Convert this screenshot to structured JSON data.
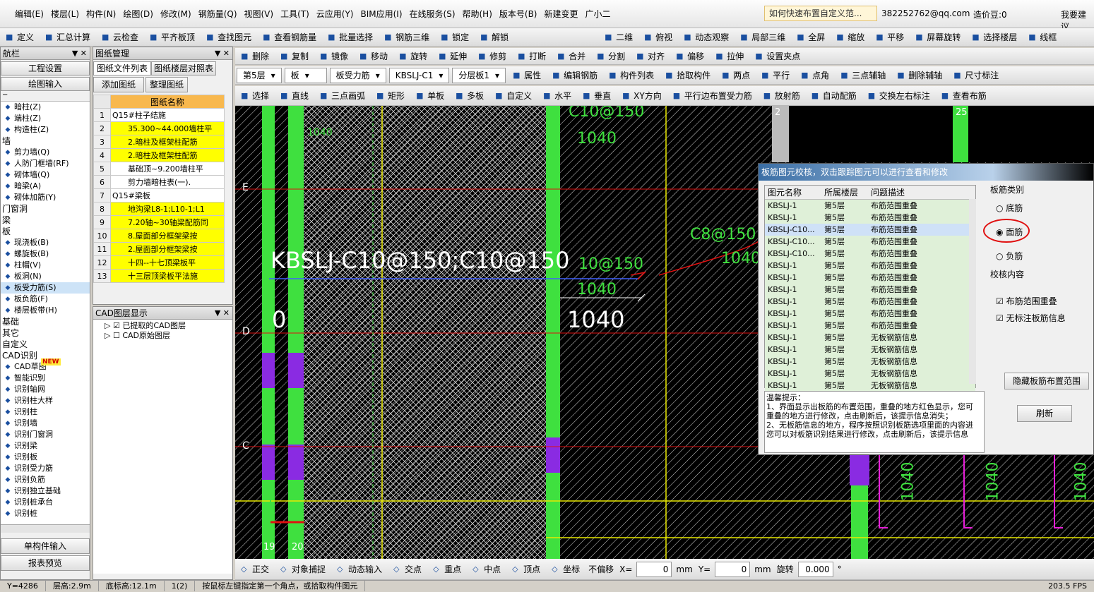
{
  "menu": [
    "编辑(E)",
    "楼层(L)",
    "构件(N)",
    "绘图(D)",
    "修改(M)",
    "钢筋量(Q)",
    "视图(V)",
    "工具(T)",
    "云应用(Y)",
    "BIM应用(I)",
    "在线服务(S)",
    "帮助(H)",
    "版本号(B)",
    "新建变更",
    "广小二"
  ],
  "menu_right": {
    "search_hint": "如何快速布置自定义范...",
    "account": "382252762@qq.com",
    "beans": "造价豆:0",
    "suggest": "我要建议"
  },
  "toolbar1": [
    "定义",
    "汇总计算",
    "云检查",
    "平齐板顶",
    "查找图元",
    "查看钢筋量",
    "批量选择",
    "钢筋三维",
    "锁定",
    "解锁"
  ],
  "toolbar1_right": [
    "二维",
    "俯视",
    "动态观察",
    "局部三维",
    "全屏",
    "缩放",
    "平移",
    "屏幕旋转",
    "选择楼层",
    "线框"
  ],
  "toolbar2": [
    "删除",
    "复制",
    "镜像",
    "移动",
    "旋转",
    "延伸",
    "修剪",
    "打断",
    "合并",
    "分割",
    "对齐",
    "偏移",
    "拉伸",
    "设置夹点"
  ],
  "toolbar3": {
    "floor": "第5层",
    "type": "板",
    "subtype": "板受力筋",
    "element": "KBSLJ-C1",
    "layer": "分层板1",
    "buttons": [
      "属性",
      "编辑钢筋",
      "构件列表",
      "拾取构件",
      "两点",
      "平行",
      "点角",
      "三点辅轴",
      "删除辅轴",
      "尺寸标注"
    ]
  },
  "toolbar4": [
    "选择",
    "直线",
    "三点画弧",
    "矩形",
    "单板",
    "多板",
    "自定义",
    "水平",
    "垂直",
    "XY方向",
    "平行边布置受力筋",
    "放射筋",
    "自动配筋",
    "交换左右标注",
    "查看布筋"
  ],
  "nav": {
    "title": "航栏",
    "top": [
      "工程设置",
      "绘图输入"
    ],
    "items": [
      {
        "t": "暗柱(Z)",
        "c": 0
      },
      {
        "t": "端柱(Z)",
        "c": 0
      },
      {
        "t": "构造柱(Z)",
        "c": 0
      },
      {
        "t": "墙",
        "c": 1
      },
      {
        "t": "剪力墙(Q)",
        "c": 0
      },
      {
        "t": "人防门框墙(RF)",
        "c": 0
      },
      {
        "t": "砌体墙(Q)",
        "c": 0
      },
      {
        "t": "暗梁(A)",
        "c": 0
      },
      {
        "t": "砌体加筋(Y)",
        "c": 0
      },
      {
        "t": "门窗洞",
        "c": 1
      },
      {
        "t": "梁",
        "c": 1
      },
      {
        "t": "板",
        "c": 1
      },
      {
        "t": "现浇板(B)",
        "c": 0
      },
      {
        "t": "螺旋板(B)",
        "c": 0
      },
      {
        "t": "柱帽(V)",
        "c": 0
      },
      {
        "t": "板洞(N)",
        "c": 0
      },
      {
        "t": "板受力筋(S)",
        "c": 0,
        "sel": 1
      },
      {
        "t": "板负筋(F)",
        "c": 0
      },
      {
        "t": "楼层板带(H)",
        "c": 0
      },
      {
        "t": "基础",
        "c": 1
      },
      {
        "t": "其它",
        "c": 1
      },
      {
        "t": "自定义",
        "c": 1
      },
      {
        "t": "CAD识别",
        "c": 1
      },
      {
        "t": "CAD草图",
        "c": 0
      },
      {
        "t": "智能识别",
        "c": 0
      },
      {
        "t": "识别轴网",
        "c": 0
      },
      {
        "t": "识别柱大样",
        "c": 0
      },
      {
        "t": "识别柱",
        "c": 0
      },
      {
        "t": "识别墙",
        "c": 0
      },
      {
        "t": "识别门窗洞",
        "c": 0
      },
      {
        "t": "识别梁",
        "c": 0
      },
      {
        "t": "识别板",
        "c": 0
      },
      {
        "t": "识别受力筋",
        "c": 0
      },
      {
        "t": "识别负筋",
        "c": 0
      },
      {
        "t": "识别独立基础",
        "c": 0
      },
      {
        "t": "识别桩承台",
        "c": 0
      },
      {
        "t": "识别桩",
        "c": 0
      }
    ],
    "bottom": [
      "单构件输入",
      "报表预览"
    ],
    "new_badge": "NEW"
  },
  "drawings": {
    "title": "图纸管理",
    "tabs": [
      "图纸文件列表",
      "图纸楼层对照表"
    ],
    "buttons": [
      "添加图纸",
      "整理图纸"
    ],
    "header": "图纸名称",
    "rows": [
      {
        "n": "1",
        "t": "Q15#柱子结施",
        "g": 1
      },
      {
        "n": "2",
        "t": "35.300~44.000墙柱平",
        "y": 1
      },
      {
        "n": "3",
        "t": "2.暗柱及框架柱配筋",
        "y": 1
      },
      {
        "n": "4",
        "t": "2.暗柱及框架柱配筋",
        "y": 1
      },
      {
        "n": "5",
        "t": "基础顶~9.200墙柱平"
      },
      {
        "n": "6",
        "t": "剪力墙暗柱表(一)."
      },
      {
        "n": "7",
        "t": "Q15#梁板",
        "g": 1
      },
      {
        "n": "8",
        "t": "地沟梁L8-1;L10-1;L1",
        "y": 1
      },
      {
        "n": "9",
        "t": "7.20轴~30轴梁配筋同",
        "y": 1
      },
      {
        "n": "10",
        "t": "8.屋面部分框架梁按",
        "y": 1
      },
      {
        "n": "11",
        "t": "2.屋面部分框架梁按",
        "y": 1
      },
      {
        "n": "12",
        "t": "十四--十七顶梁板平",
        "y": 1
      },
      {
        "n": "13",
        "t": "十三层顶梁板平法施",
        "y": 1
      }
    ]
  },
  "cad_layers": {
    "title": "CAD图层显示",
    "items": [
      "已提取的CAD图层",
      "CAD原始图层"
    ]
  },
  "canvas": {
    "labels": {
      "c10a": "C10@150",
      "n1040a": "1040",
      "main": "KBSLJ-C10@150;C10@150",
      "c10b": "10@150",
      "n1040b": "1040",
      "zero": "0",
      "n1040c": "1040",
      "c8": "C8@150",
      "n1040d": "1040",
      "e": "E",
      "d": "D",
      "c": "C",
      "v1": "1040",
      "v2": "1040",
      "v3": "1040",
      "a19": "19",
      "a20": "20",
      "n2": "2",
      "n25": "25",
      "w1040": "1040"
    }
  },
  "dialog": {
    "title": "板筋图元校核，双击跟踪图元可以进行查看和修改",
    "cols": [
      "图元名称",
      "所属楼层",
      "问题描述"
    ],
    "rows": [
      [
        "KBSLJ-1",
        "第5层",
        "布筋范围重叠"
      ],
      [
        "KBSLJ-1",
        "第5层",
        "布筋范围重叠"
      ],
      [
        "KBSLJ-C10...",
        "第5层",
        "布筋范围重叠"
      ],
      [
        "KBSLJ-C10...",
        "第5层",
        "布筋范围重叠"
      ],
      [
        "KBSLJ-C10...",
        "第5层",
        "布筋范围重叠"
      ],
      [
        "KBSLJ-1",
        "第5层",
        "布筋范围重叠"
      ],
      [
        "KBSLJ-1",
        "第5层",
        "布筋范围重叠"
      ],
      [
        "KBSLJ-1",
        "第5层",
        "布筋范围重叠"
      ],
      [
        "KBSLJ-1",
        "第5层",
        "布筋范围重叠"
      ],
      [
        "KBSLJ-1",
        "第5层",
        "布筋范围重叠"
      ],
      [
        "KBSLJ-1",
        "第5层",
        "布筋范围重叠"
      ],
      [
        "KBSLJ-1",
        "第5层",
        "无板钢筋信息"
      ],
      [
        "KBSLJ-1",
        "第5层",
        "无板钢筋信息"
      ],
      [
        "KBSLJ-1",
        "第5层",
        "无板钢筋信息"
      ],
      [
        "KBSLJ-1",
        "第5层",
        "无板钢筋信息"
      ],
      [
        "KBSLJ-1",
        "第5层",
        "无板钢筋信息"
      ]
    ],
    "tip_title": "温馨提示：",
    "tips": [
      "1、界面显示出板筋的布置范围，重叠的地方红色显示，您可",
      "重叠的地方进行修改，点击刷新后，该提示信息消失；",
      "2、无板筋信息的地方，程序按照识别板筋选项里面的内容进",
      "您可以对板筋识别结果进行修改，点击刷新后，该提示信息"
    ],
    "cat_title": "板筋类别",
    "cats": [
      "底筋",
      "面筋",
      "负筋"
    ],
    "check_title": "校核内容",
    "checks": [
      "布筋范围重叠",
      "无标注板筋信息"
    ],
    "hide_btn": "隐藏板筋布置范围",
    "refresh_btn": "刷新"
  },
  "snapbar": {
    "items": [
      "正交",
      "对象捕捉",
      "动态输入",
      "交点",
      "重点",
      "中点",
      "顶点",
      "坐标"
    ],
    "offset": "不偏移",
    "x_label": "X=",
    "x_val": "0",
    "y_label": "Y=",
    "y_val": "0",
    "unit": "mm",
    "rotate": "旋转",
    "rot_val": "0.000",
    "deg": "°"
  },
  "status": {
    "items": [
      "Y=4286",
      "层高:2.9m",
      "底标高:12.1m",
      "1(2)",
      "按鼠标左键指定第一个角点，或拾取构件图元"
    ],
    "fps": "203.5 FPS"
  }
}
